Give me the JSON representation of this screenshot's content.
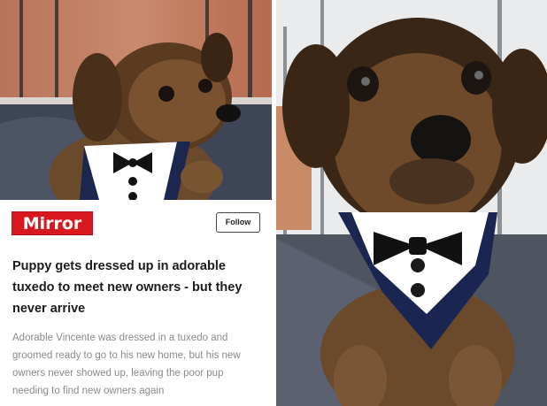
{
  "article": {
    "publisher": "Mirror",
    "follow_label": "Follow",
    "headline": "Puppy gets dressed up in adorable tuxedo to meet new owners - but they never arrive",
    "summary": "Adorable Vincente was dressed in a tuxedo and groomed ready to go to his new home, but his new owners never showed up, leaving the poor pup needing to find new owners again"
  },
  "colors": {
    "brand": "#d7191f"
  }
}
